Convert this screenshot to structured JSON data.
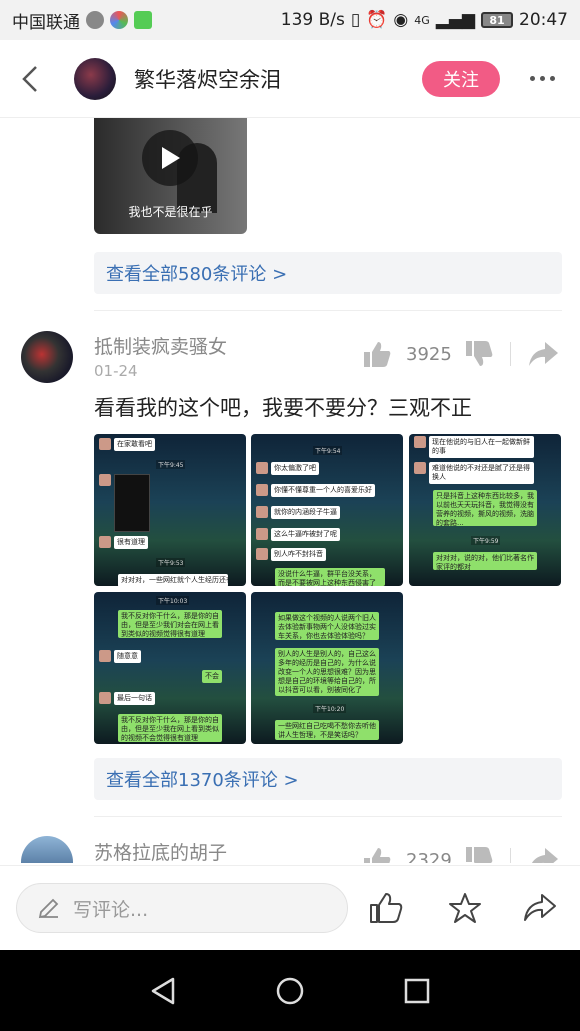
{
  "status_bar": {
    "carrier": "中国联通",
    "speed": "139 B/s",
    "network": "4G",
    "battery": "81",
    "time": "20:47"
  },
  "header": {
    "title": "繁华落烬空余泪",
    "follow_label": "关注"
  },
  "video": {
    "caption": "我也不是很在乎"
  },
  "post1": {
    "see_all": "查看全部580条评论 >"
  },
  "comment": {
    "username": "抵制装疯卖骚女",
    "date": "01-24",
    "likes": "3925",
    "text": "看看我的这个吧，我要不要分？三观不正",
    "see_all": "查看全部1370条评论 >"
  },
  "comment2": {
    "username": "苏格拉底的胡子",
    "likes": "2329"
  },
  "screenshots": {
    "s1": {
      "b1": "在家敢看吧",
      "t1": "下午9:45",
      "b2": "很有道理",
      "t2": "下午9:53",
      "b3": "对对对，一些网红就个人生经历还有能吧，为什么就要..."
    },
    "s2": {
      "t1": "下午9:54",
      "b1": "你太偏激了吧",
      "b2": "你懂不懂尊重一个人的喜爱乐好",
      "b3": "就你的内涵段子牛逼",
      "b4": "这么牛逼咋被封了呢",
      "b5": "别人咋不封抖音",
      "b6": "没说什么牛逼，群平台没关系，而是不要被网上这种东西侵害了明白吗"
    },
    "s3": {
      "b1": "现在他说的与旧人在一起做新鲜的事",
      "b2": "难道他说的不对还是腻了还是得换人",
      "b3": "只是抖音上这种东西比较多，我以前也天天玩抖音，我觉得没有营养的视频，撕风的视频，洗脑的套路...",
      "t1": "下午9:59",
      "b4": "对对对，说的对，他们比著名作家评的都对"
    },
    "s4": {
      "t1": "下午10:03",
      "b1": "我不反对你干什么，那是你的自由，但是至少我们对会在网上看到类似的视频觉得很有道理",
      "b2": "随意意",
      "b3": "不会",
      "b4": "最后一句话",
      "b5": "我不反对你干什么，那是你的自由，但是至少我在网上看到类似的视频不会觉得很有道理"
    },
    "s5": {
      "b1": "如果做这个视频的人说两个旧人去体验新事物两个人没体验过实车关系，你也去体验体验吗？",
      "b2": "别人的人生是别人的，自己这么多年的经历是自己的，为什么说改变一个人的思想很难？因为思想是自己的环境等给自己的，所以抖音可以看，别被同化了",
      "t1": "下午10:20",
      "b3": "一些网红自己吃喝不愁你去听他讲人生哲理，不是笑话吗？"
    }
  },
  "bottom": {
    "comment_placeholder": "写评论..."
  }
}
